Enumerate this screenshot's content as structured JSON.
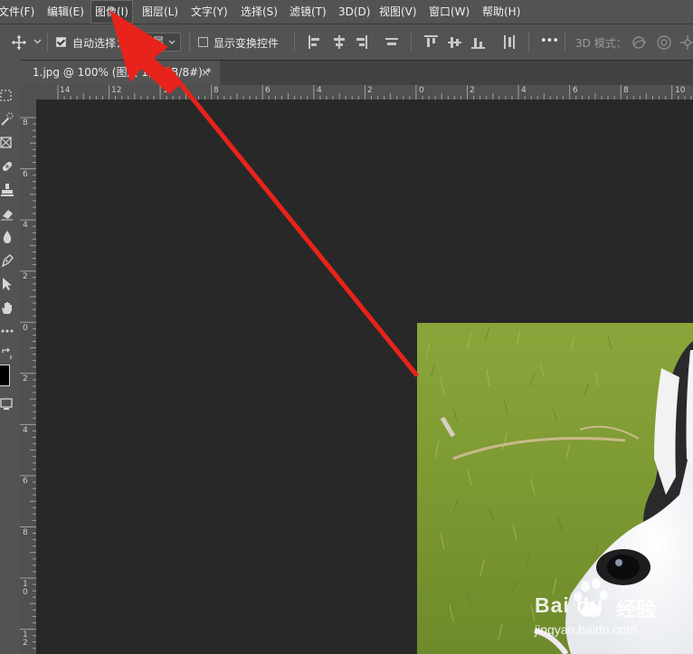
{
  "menubar": {
    "items": [
      "文件(F)",
      "编辑(E)",
      "图像(I)",
      "图层(L)",
      "文字(Y)",
      "选择(S)",
      "滤镜(T)",
      "3D(D)",
      "视图(V)",
      "窗口(W)",
      "帮助(H)"
    ],
    "active_item": "图像(I)"
  },
  "options_bar": {
    "auto_select_label": "自动选择：",
    "auto_select_checked": true,
    "layer_dropdown_value": "图层",
    "show_transform_label": "显示变换控件",
    "show_transform_checked": false,
    "more_label": "•••",
    "mode_3d_label": "3D 模式："
  },
  "document_tab": {
    "title": "1.jpg @ 100% (图层 1, RGB/8#) *",
    "close_label": "×"
  },
  "ruler_h": {
    "labels": [
      "14",
      "12",
      "10",
      "8",
      "6",
      "4",
      "2",
      "0",
      "2",
      "4",
      "6",
      "8",
      "10"
    ]
  },
  "ruler_v": {
    "labels": [
      "8",
      "6",
      "4",
      "2",
      "0",
      "2",
      "4",
      "6",
      "8",
      "10",
      "12"
    ]
  },
  "watermark": {
    "brand_text": "Bai du",
    "experience_text": "经验",
    "url_text": "jingyan.baidu.com"
  },
  "colors": {
    "menubar_bg": "#535353",
    "canvas_bg": "#282828",
    "arrow": "#e8231b",
    "grass": "#7d9a33"
  },
  "annotation": {
    "type": "red-arrow",
    "points_to": "图像(I)"
  }
}
